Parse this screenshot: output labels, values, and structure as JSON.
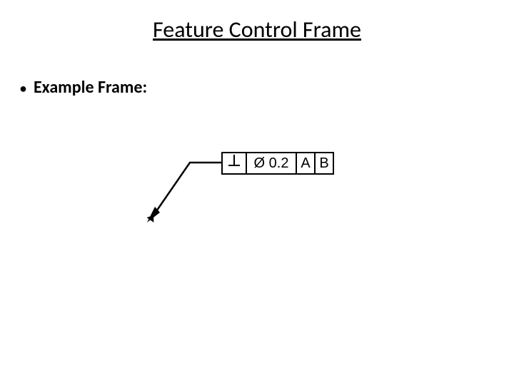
{
  "title": "Feature Control Frame",
  "bullet": "Example Frame:",
  "fcf": {
    "geometric_symbol_name": "perpendicularity",
    "tolerance": "Ø 0.2",
    "datums": [
      "A",
      "B"
    ]
  }
}
